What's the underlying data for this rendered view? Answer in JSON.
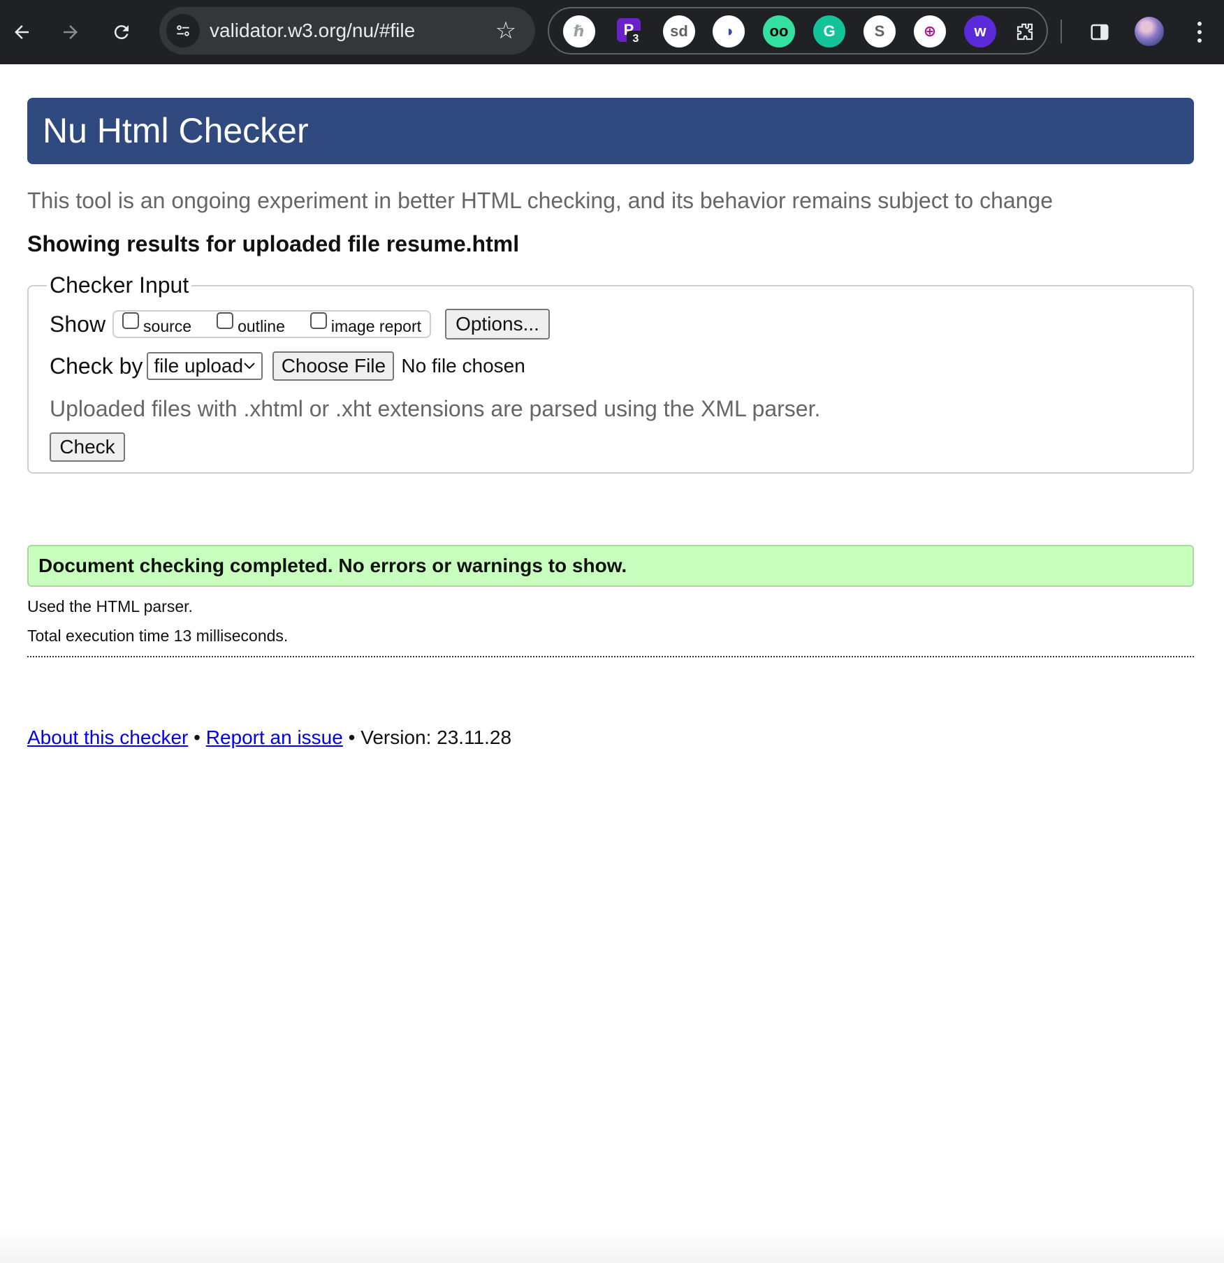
{
  "browser": {
    "url": "validator.w3.org/nu/#file",
    "extensions": [
      {
        "icon": "ext-h-icon",
        "bg": "#ffffff",
        "fg": "#9aa0a6",
        "glyph": "ℏ"
      },
      {
        "icon": "ext-p-icon",
        "bg": "#6b21c8",
        "fg": "#ffffff",
        "glyph": "P",
        "badge": "3"
      },
      {
        "icon": "ext-sd-icon",
        "bg": "#ffffff",
        "fg": "#5f6368",
        "glyph": "sd"
      },
      {
        "icon": "ext-southwest-icon",
        "bg": "#ffffff",
        "fg": "#304cb2",
        "glyph": "◑"
      },
      {
        "icon": "ext-tripadvisor-icon",
        "bg": "#34e0a1",
        "fg": "#000000",
        "glyph": "oo"
      },
      {
        "icon": "ext-grammarly-icon",
        "bg": "#15c39a",
        "fg": "#ffffff",
        "glyph": "G"
      },
      {
        "icon": "ext-s-icon",
        "bg": "#ffffff",
        "fg": "#5f6368",
        "glyph": "S"
      },
      {
        "icon": "ext-globe-icon",
        "bg": "#ffffff",
        "fg": "#b0158c",
        "glyph": "⊕"
      },
      {
        "icon": "ext-w-icon",
        "bg": "#5b2bd9",
        "fg": "#ffffff",
        "glyph": "w"
      }
    ]
  },
  "page": {
    "title": "Nu Html Checker",
    "tagline": "This tool is an ongoing experiment in better HTML checking, and its behavior remains subject to change",
    "results_heading": "Showing results for uploaded file resume.html",
    "checker": {
      "legend": "Checker Input",
      "show_label": "Show",
      "options": [
        "source",
        "outline",
        "image report"
      ],
      "options_button": "Options...",
      "check_by_label": "Check by",
      "check_by_value": "file upload",
      "choose_file": "Choose File",
      "no_file": "No file chosen",
      "hint": "Uploaded files with .xhtml or .xht extensions are parsed using the XML parser.",
      "check_button": "Check"
    },
    "result": {
      "message": "Document checking completed. No errors or warnings to show.",
      "parser": "Used the HTML parser.",
      "time": "Total execution time 13 milliseconds."
    },
    "footer": {
      "about": "About this checker",
      "sep": "•",
      "report": "Report an issue",
      "version": "• Version: 23.11.28"
    }
  },
  "colors": {
    "banner": "#304a80",
    "success_bg": "#c8ffbe",
    "link": "#0000ee"
  }
}
